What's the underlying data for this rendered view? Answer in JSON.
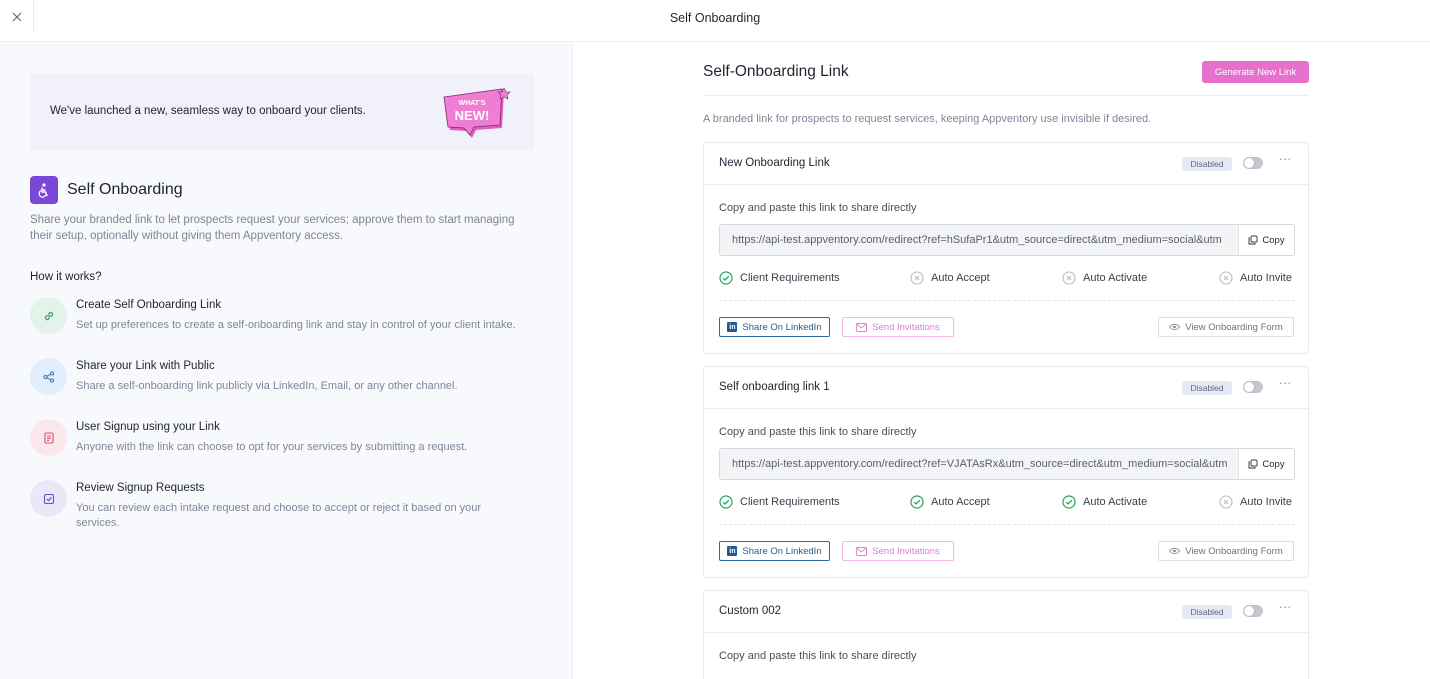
{
  "header": {
    "title": "Self Onboarding"
  },
  "banner": {
    "text": "We've launched a new, seamless way to onboard your clients.",
    "badge_line1": "WHAT'S",
    "badge_line2": "NEW!"
  },
  "intro": {
    "title": "Self Onboarding",
    "description": "Share your branded link to let prospects request your services; approve them to start managing their setup, optionally without giving them Appventory access.",
    "how_title": "How it works?"
  },
  "steps": [
    {
      "title": "Create Self Onboarding Link",
      "description": "Set up preferences to create a self-onboarding link and stay in control of your client intake.",
      "icon": "link-icon"
    },
    {
      "title": "Share your Link with Public",
      "description": "Share a self-onboarding link publicly via LinkedIn, Email, or any other channel.",
      "icon": "share-icon"
    },
    {
      "title": "User Signup using your Link",
      "description": "Anyone with the link can choose to opt for your services by submitting a request.",
      "icon": "document-icon"
    },
    {
      "title": "Review Signup Requests",
      "description": "You can review each intake request and choose to accept or reject it based on your services.",
      "icon": "checkbox-icon"
    }
  ],
  "main": {
    "title": "Self-Onboarding Link",
    "generate_label": "Generate New Link",
    "description": "A branded link for prospects to request services, keeping Appventory use invisible if desired."
  },
  "card_labels": {
    "copy_label": "Copy and paste this link to share directly",
    "copy_button": "Copy",
    "linkedin_button": "Share On LinkedIn",
    "invite_button": "Send Invitations",
    "view_button": "View Onboarding Form",
    "more": "···"
  },
  "cards": [
    {
      "name": "New Onboarding Link",
      "status": "Disabled",
      "enabled": false,
      "url": "https://api-test.appventory.com/redirect?ref=hSufaPr1&utm_source=direct&utm_medium=social&utm",
      "features": [
        {
          "label": "Client Requirements",
          "enabled": true
        },
        {
          "label": "Auto Accept",
          "enabled": false
        },
        {
          "label": "Auto Activate",
          "enabled": false
        },
        {
          "label": "Auto Invite",
          "enabled": false
        }
      ]
    },
    {
      "name": "Self onboarding link 1",
      "status": "Disabled",
      "enabled": false,
      "url": "https://api-test.appventory.com/redirect?ref=VJATAsRx&utm_source=direct&utm_medium=social&utm",
      "features": [
        {
          "label": "Client Requirements",
          "enabled": true
        },
        {
          "label": "Auto Accept",
          "enabled": true
        },
        {
          "label": "Auto Activate",
          "enabled": true
        },
        {
          "label": "Auto Invite",
          "enabled": false
        }
      ]
    },
    {
      "name": "Custom 002",
      "status": "Disabled",
      "enabled": false
    }
  ],
  "colors": {
    "accent": "#e76fce",
    "brand_purple": "#7a47d6",
    "check_green": "#27a35a",
    "linkedin_blue": "#1e5c92"
  }
}
